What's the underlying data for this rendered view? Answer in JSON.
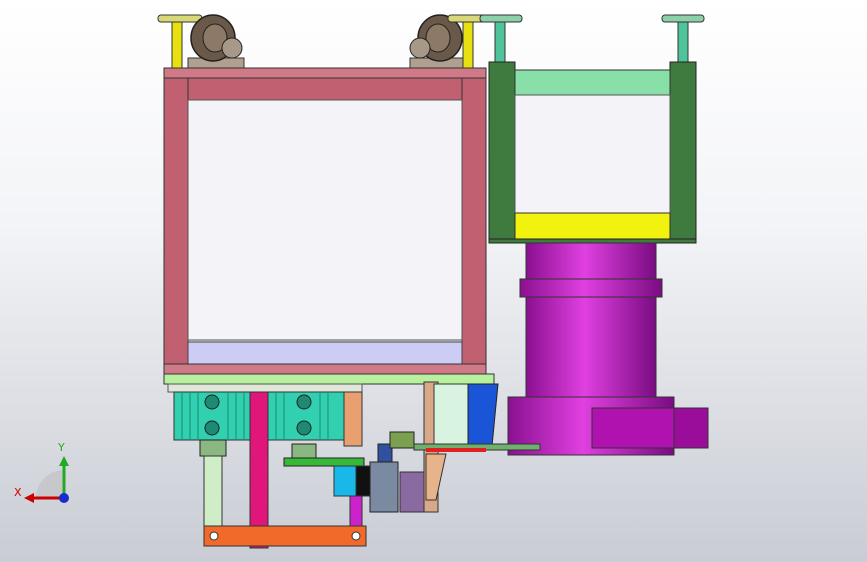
{
  "viewport": {
    "background_top": "#ffffff",
    "background_bottom": "#c9ccd4"
  },
  "triad": {
    "x_label": "X",
    "y_label": "Y",
    "x_color": "#cc0000",
    "y_color": "#22aa22",
    "z_color": "#1a2acc"
  },
  "colors": {
    "frame_left": "#c06070",
    "frame_right": "#3f7a3f",
    "top_bar_right": "#88e0a8",
    "yellow_plate": "#f2f20f",
    "cylinder": "#cc22cc",
    "caster_metal": "#7a6a5a",
    "leveling_foot": "#4fc49a",
    "base_plate": "#b8f0a0",
    "bottom_arm": "#f26a2a",
    "pink_link": "#e0167a",
    "teal_block": "#30d0b0",
    "blue_block": "#1a55d8"
  }
}
